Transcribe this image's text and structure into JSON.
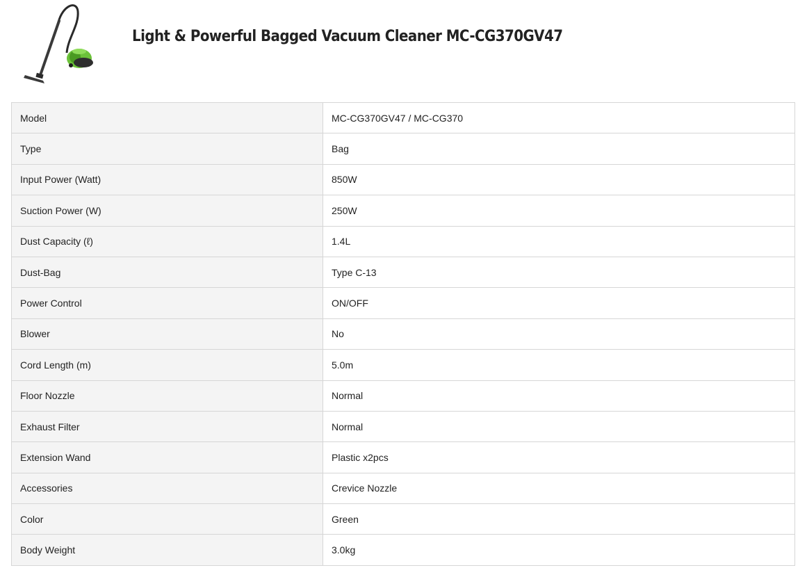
{
  "header": {
    "title": "Light & Powerful Bagged Vacuum Cleaner MC-CG370GV47",
    "image_icon": "vacuum-cleaner-image",
    "accent_color": "#6cc23a"
  },
  "specs": [
    {
      "label": "Model",
      "value": "MC-CG370GV47 / MC-CG370"
    },
    {
      "label": "Type",
      "value": "Bag"
    },
    {
      "label": "Input Power (Watt)",
      "value": "850W"
    },
    {
      "label": "Suction Power (W)",
      "value": "250W"
    },
    {
      "label": "Dust Capacity (ℓ)",
      "value": "1.4L"
    },
    {
      "label": "Dust-Bag",
      "value": "Type C-13"
    },
    {
      "label": "Power Control",
      "value": "ON/OFF"
    },
    {
      "label": "Blower",
      "value": "No"
    },
    {
      "label": "Cord Length (m)",
      "value": "5.0m"
    },
    {
      "label": "Floor Nozzle",
      "value": "Normal"
    },
    {
      "label": "Exhaust Filter",
      "value": "Normal"
    },
    {
      "label": "Extension Wand",
      "value": "Plastic x2pcs"
    },
    {
      "label": "Accessories",
      "value": "Crevice Nozzle"
    },
    {
      "label": "Color",
      "value": "Green"
    },
    {
      "label": "Body Weight",
      "value": "3.0kg"
    }
  ]
}
